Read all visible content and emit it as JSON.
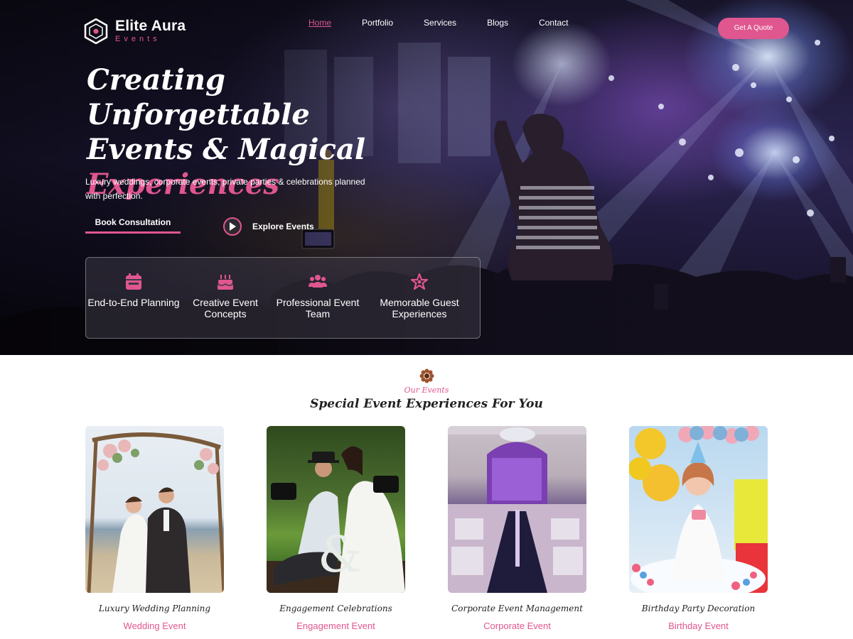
{
  "brand": {
    "name": "Elite Aura",
    "tagline": "Events"
  },
  "nav": {
    "items": [
      {
        "label": "Home",
        "active": true
      },
      {
        "label": "Portfolio",
        "active": false
      },
      {
        "label": "Services",
        "active": false
      },
      {
        "label": "Blogs",
        "active": false
      },
      {
        "label": "Contact",
        "active": false
      }
    ],
    "cta_label": "Get A Quote"
  },
  "hero": {
    "headline_line1": "Creating Unforgettable",
    "headline_line2": "Events & Magical",
    "headline_accent": "Experiences",
    "subtext": "Luxury weddings, corporate events, private parties & celebrations planned with perfection.",
    "primary_button": "Book Consultation",
    "secondary_button": "Explore Events",
    "secondary_icon": "play-icon"
  },
  "features": [
    {
      "icon": "calendar-icon",
      "label": "End-to-End Planning"
    },
    {
      "icon": "cake-icon",
      "label": "Creative Event Concepts"
    },
    {
      "icon": "team-icon",
      "label": "Professional Event Team"
    },
    {
      "icon": "star-icon",
      "label": "Memorable Guest Experiences"
    }
  ],
  "events_section": {
    "eyebrow": "Our Events",
    "title": "Special Event Experiences For You",
    "cards": [
      {
        "title": "Luxury Wedding Planning",
        "tag": "Wedding Event"
      },
      {
        "title": "Engagement Celebrations",
        "tag": "Engagement Event"
      },
      {
        "title": "Corporate Event Management",
        "tag": "Corporate Event"
      },
      {
        "title": "Birthday Party Decoration",
        "tag": "Birthday Event"
      }
    ]
  },
  "colors": {
    "accent": "#e0568f",
    "text_dark": "#222222",
    "white": "#ffffff"
  }
}
